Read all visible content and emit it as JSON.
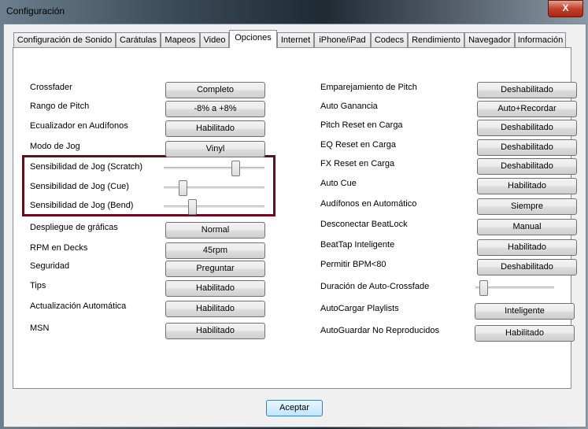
{
  "window": {
    "title": "Configuración",
    "close": "X"
  },
  "tabs": [
    "Configuración de Sonido",
    "Carátulas",
    "Mapeos",
    "Video",
    "Opciones",
    "Internet",
    "iPhone/iPad",
    "Codecs",
    "Rendimiento",
    "Navegador",
    "Información"
  ],
  "active_tab": "Opciones",
  "left": [
    {
      "label": "Crossfader",
      "value": "Completo"
    },
    {
      "label": "Rango de Pitch",
      "value": "-8% a +8%"
    },
    {
      "label": "Ecualizador en Audífonos",
      "value": "Habilitado"
    },
    {
      "label": "Modo de Jog",
      "value": "Vinyl"
    },
    {
      "label": "Sensibilidad de Jog (Scratch)",
      "slider": 0.73
    },
    {
      "label": "Sensibilidad de Jog (Cue)",
      "slider": 0.16
    },
    {
      "label": "Sensibilidad de Jog (Bend)",
      "slider": 0.26
    },
    {
      "label": "Despliegue de gráficas",
      "value": "Normal"
    },
    {
      "label": "RPM en Decks",
      "value": "45rpm"
    },
    {
      "label": "Seguridad",
      "value": "Preguntar"
    },
    {
      "label": "Tips",
      "value": "Habilitado"
    },
    {
      "label": "Actualización Automática",
      "value": "Habilitado"
    },
    {
      "label": "MSN",
      "value": "Habilitado"
    }
  ],
  "right": [
    {
      "label": "Emparejamiento de Pitch",
      "value": "Deshabilitado"
    },
    {
      "label": "Auto Ganancia",
      "value": "Auto+Recordar"
    },
    {
      "label": "Pitch Reset en Carga",
      "value": "Deshabilitado"
    },
    {
      "label": "EQ Reset en Carga",
      "value": "Deshabilitado"
    },
    {
      "label": "FX Reset en Carga",
      "value": "Deshabilitado"
    },
    {
      "label": "Auto Cue",
      "value": "Habilitado"
    },
    {
      "label": "Audífonos en Automático",
      "value": "Siempre"
    },
    {
      "label": "Desconectar BeatLock",
      "value": "Manual"
    },
    {
      "label": "BeatTap Inteligente",
      "value": "Habilitado"
    },
    {
      "label": "Permitir BPM<80",
      "value": "Deshabilitado"
    },
    {
      "label": "Duración de Auto-Crossfade",
      "slider": 0.06
    },
    {
      "label": "AutoCargar Playlists",
      "value": "Inteligente"
    },
    {
      "label": "AutoGuardar No Reproducidos",
      "value": "Habilitado"
    }
  ],
  "ok_label": "Aceptar"
}
